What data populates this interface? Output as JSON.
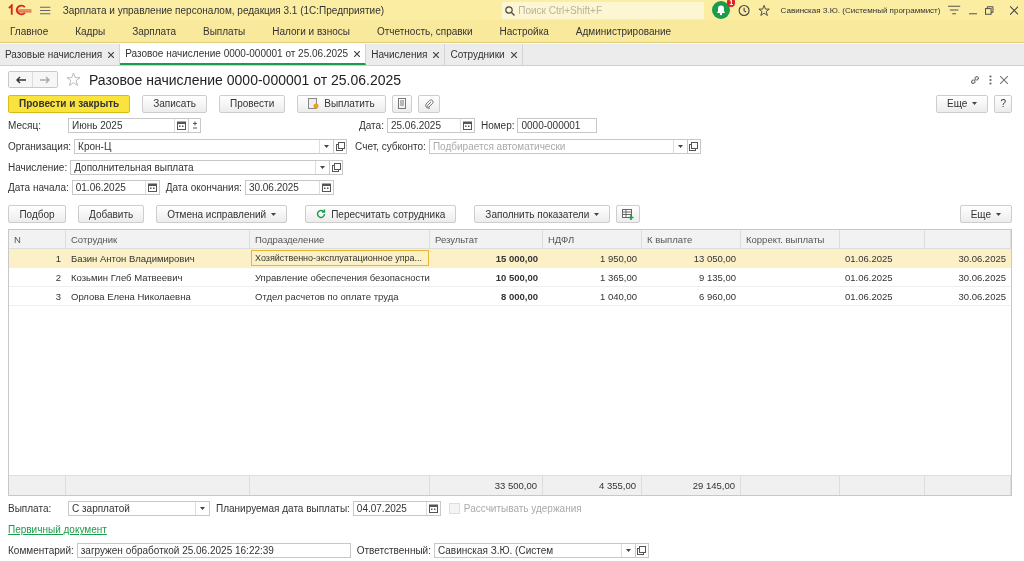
{
  "app": {
    "title": "Зарплата и управление персоналом, редакция 3.1  (1С:Предприятие)",
    "search_placeholder": "Поиск Ctrl+Shift+F",
    "notifications": "1",
    "user": "Савинская З.Ю. (Системный программист)"
  },
  "menu": [
    "Главное",
    "Кадры",
    "Зарплата",
    "Выплаты",
    "Налоги и взносы",
    "Отчетность, справки",
    "Настройка",
    "Администрирование"
  ],
  "tabs": [
    {
      "label": "Разовые начисления",
      "selected": false
    },
    {
      "label": "Разовое начисление 0000-000001 от 25.06.2025",
      "selected": true
    },
    {
      "label": "Начисления",
      "selected": false
    },
    {
      "label": "Сотрудники",
      "selected": false
    }
  ],
  "document": {
    "title": "Разовое начисление 0000-000001 от 25.06.2025"
  },
  "toolbar": {
    "primary": "Провести и закрыть",
    "write": "Записать",
    "post": "Провести",
    "pay": "Выплатить",
    "more": "Еще",
    "help": "?"
  },
  "fields": {
    "month_label": "Месяц:",
    "month": "Июнь 2025",
    "date_label": "Дата:",
    "date": "25.06.2025",
    "number_label": "Номер:",
    "number": "0000-000001",
    "org_label": "Организация:",
    "org": "Крон-Ц",
    "account_label": "Счет, субконто:",
    "account_placeholder": "Подбирается автоматически",
    "accrual_label": "Начисление:",
    "accrual": "Дополнительная выплата",
    "start_label": "Дата начала:",
    "start": "01.06.2025",
    "end_label": "Дата окончания:",
    "end": "30.06.2025"
  },
  "table_toolbar": {
    "pick": "Подбор",
    "add": "Добавить",
    "cancel_fixes": "Отмена исправлений",
    "recalc": "Пересчитать сотрудника",
    "fill": "Заполнить показатели",
    "more": "Еще"
  },
  "table": {
    "columns": [
      "N",
      "Сотрудник",
      "Подразделение",
      "Результат",
      "НДФЛ",
      "К выплате",
      "Коррект. выплаты"
    ],
    "rows": [
      {
        "n": "1",
        "employee": "Базин Антон Владимирович",
        "department": "Хозяйственно-эксплуатационное упра...",
        "result": "15 000,00",
        "ndfl": "1 950,00",
        "payout": "13 050,00",
        "start": "01.06.2025",
        "end": "30.06.2025",
        "selected": true
      },
      {
        "n": "2",
        "employee": "Козьмин Глеб Матвеевич",
        "department": "Управление обеспечения безопасности",
        "result": "10 500,00",
        "ndfl": "1 365,00",
        "payout": "9 135,00",
        "start": "01.06.2025",
        "end": "30.06.2025",
        "selected": false
      },
      {
        "n": "3",
        "employee": "Орлова Елена Николаевна",
        "department": "Отдел расчетов по оплате труда",
        "result": "8 000,00",
        "ndfl": "1 040,00",
        "payout": "6 960,00",
        "start": "01.06.2025",
        "end": "30.06.2025",
        "selected": false
      }
    ],
    "totals": {
      "result": "33 500,00",
      "ndfl": "4 355,00",
      "payout": "29 145,00"
    }
  },
  "footer": {
    "payment_label": "Выплата:",
    "payment": "С зарплатой",
    "planned_label": "Планируемая дата выплаты:",
    "planned": "04.07.2025",
    "withhold": {
      "label": "Рассчитывать удержания",
      "checked": false,
      "disabled": true
    },
    "link": "Первичный документ",
    "comment_label": "Комментарий:",
    "comment": "загружен обработкой 25.06.2025 16:22:39",
    "responsible_label": "Ответственный:",
    "responsible": "Савинская З.Ю. (Систем"
  }
}
